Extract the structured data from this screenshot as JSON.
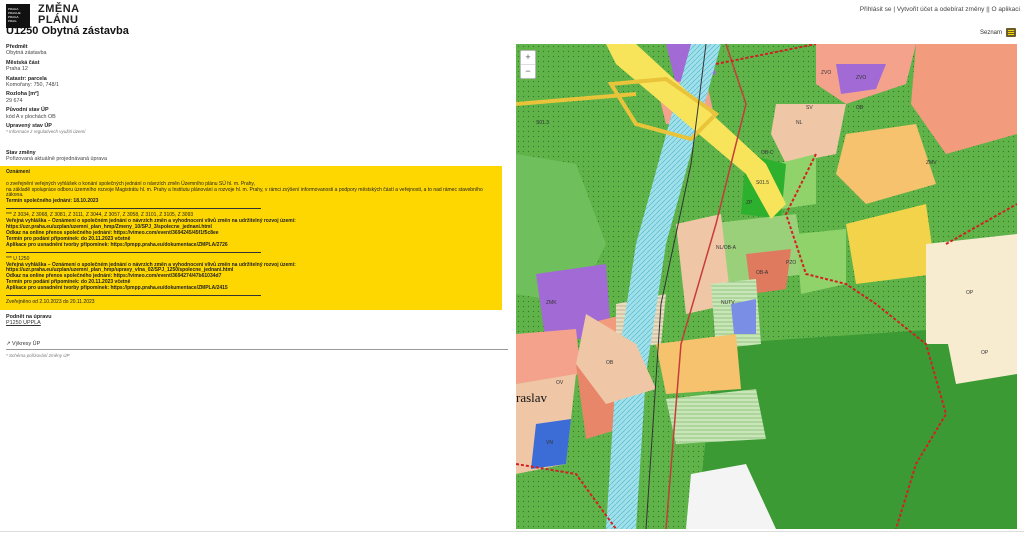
{
  "brand": {
    "logo_lines": [
      "PRAHA",
      "PRAGUE",
      "PRAGA",
      "PRAG"
    ],
    "name_line1": "ZMĚNA",
    "name_line2": "PLÁNU"
  },
  "page_title": "U1250 Obytná zástavba",
  "topnav": {
    "login": "Přihlásit se",
    "sep": "|",
    "register": "Vytvořit účet a odebírat změny",
    "sep2": "||",
    "about": "O aplikaci"
  },
  "seznam_label": "Seznam",
  "fields": {
    "predmet_label": "Předmět",
    "predmet_value": "Obytná zástavba",
    "mestska_cast_label": "Městská část",
    "mestska_cast_value": "Praha 12",
    "katastr_label": "Katastr: parcela",
    "katastr_value": "Komořany: 750, 748/1",
    "rozloha_label": "Rozloha [m²]",
    "rozloha_value": "29 674",
    "puvodni_label": "Původní stav ÚP",
    "puvodni_value": "kód A v plochách OB",
    "upraveny_label": "Upravený stav ÚP",
    "upraveny_note": "* Informace z regulativech využití území",
    "stav_label": "Stav změny",
    "stav_value": "Pořizovaná aktuálně projednávaná úprava"
  },
  "notice": {
    "heading": "Oznámení",
    "p1": "o zveřejnění veřejných vyhlášek o konání společných jednání o návrzích změn Územního plánu SÚ hl. m. Prahy,",
    "p2": "na základě spolupráce odboru územního rozvoje Magistrátu hl. m. Prahy a Institutu plánování a rozvoje hl. m. Prahy, v rámci zvýšení informovanosti a podpory městských částí a veřejnosti, a to nad rámec stavebního zákona.",
    "p3": "Termín společného jednání: 18.10.2023",
    "b1_line1": "*** Z 3034, Z 3068, Z 3081, Z 3111, Z 3044, Z 3057, Z 3058, Z 3101, Z 3105, Z 3093",
    "b1_line2": "Veřejná vyhláška – Oznámení o společném jednání o návrzích změn a vyhodnocení vlivů změn na udržitelný rozvoj území:",
    "b1_line3": "https://uzr.praha.eu/uzplan/uzemni_plan_hmp/Zmeny_10/SPJ_3/spolecne_jednani.html",
    "b1_line4": "Odkaz na online přenos společného jednání: https://vimeo.com/event/3694245/45f1f5c8ee",
    "b1_line5": "Termín pro podání připomínek: do 20.11.2023 včetně",
    "b1_line6": "Aplikace pro usnadnění tvorby připomínek: https://pmpp.praha.eu/dokumentace/ZMPLA/2726",
    "b2_line1": "*** U 1250",
    "b2_line2": "Veřejná vyhláška – Oznámení o společném jednání o návrzích změn a vyhodnocení vlivů změn na udržitelný rozvoj území:",
    "b2_line3": "https://uzr.praha.eu/uzplan/uzemni_plan_hmp/upravy_vlna_02/SPJ_1250/spolecne_jednani.html",
    "b2_line4": "Odkaz na online přenos společného jednání: https://vimeo.com/event/3694274/47b61034d7",
    "b2_line5": "Termín pro podání připomínek: do 20.11.2023 včetně",
    "b2_line6": "Aplikace pro usnadnění tvorby připomínek: https://pmpp.praha.eu/dokumentace/ZMPLA/2415",
    "published": "Zveřejněno od 2.10.2023 do 20.11.2023"
  },
  "podnet": {
    "label": "Podnět na úpravu",
    "link": "P1250 UPPLA"
  },
  "vykresy": {
    "label": "↗ Výkresy ÚP",
    "note": "* Schéma pořizování změny ÚP"
  },
  "map": {
    "zoom_in": "+",
    "zoom_out": "−",
    "zone_labels": [
      "ZVO",
      "ZVO",
      "NL",
      "SV",
      "OB",
      "ZMK",
      "OB",
      "OV",
      "ZP",
      "DV",
      "ZP",
      "OB-A",
      "PZO",
      "PZO",
      "ZMV",
      "OP",
      "OP",
      "ZMK",
      "SV",
      "VN",
      "OB",
      "ZMV",
      "NL",
      "ZMK",
      "SV",
      "ZMK",
      "OB-C",
      "NL/OB-A",
      "PZO",
      "S01.5",
      "S01.3",
      "OV",
      "ZMV",
      "VB",
      "OB",
      "ZP",
      "NUTV",
      "OB-A"
    ],
    "place_label": "raslav"
  }
}
